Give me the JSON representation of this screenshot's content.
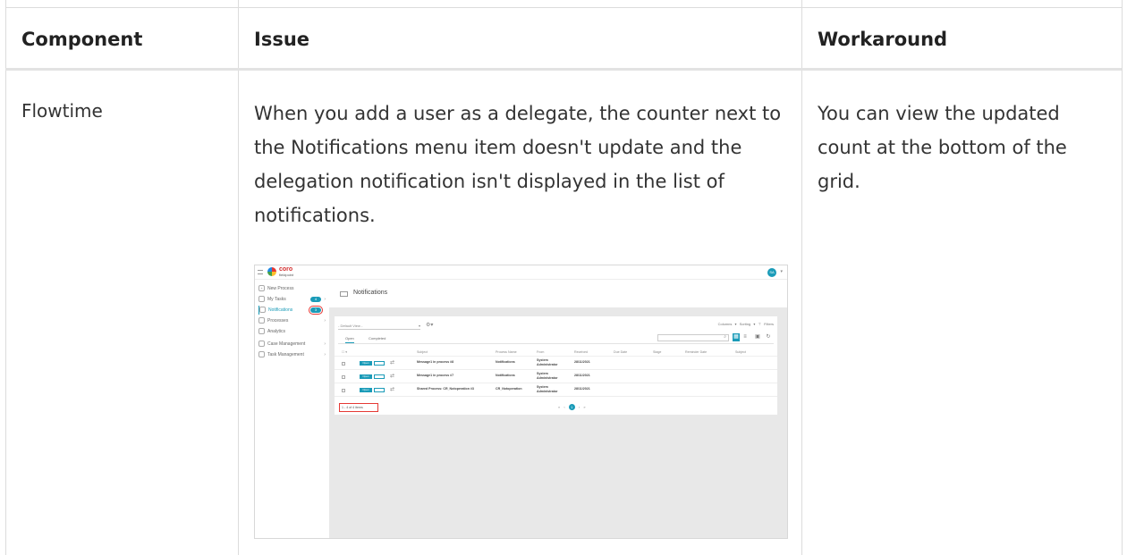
{
  "table": {
    "headers": {
      "component": "Component",
      "issue": "Issue",
      "workaround": "Workaround"
    },
    "rows": [
      {
        "component": "Flowtime",
        "issue": "When you add a user as a delegate, the counter next to the Notifications menu item doesn't update and the delegation notification isn't displayed in the list of notifications.",
        "workaround": "You can view the updated count at the bottom of the grid."
      }
    ]
  },
  "screenshot": {
    "logo": {
      "name": "coro",
      "sub": "fieldpoint"
    },
    "avatar": "SA",
    "nav": [
      {
        "label": "New Process",
        "icon": "plus-icon"
      },
      {
        "label": "My Tasks",
        "icon": "tasks-icon",
        "badge": "4"
      },
      {
        "label": "Notifications",
        "icon": "mail-icon",
        "badge": "3",
        "active": true
      },
      {
        "label": "Processes",
        "icon": "processes-icon"
      },
      {
        "label": "Analytics",
        "icon": "analytics-icon"
      },
      {
        "label": "Case Management",
        "icon": "folder-icon"
      },
      {
        "label": "Task Management",
        "icon": "clipboard-icon"
      }
    ],
    "page_title": "Notifications",
    "view_select": "- Default View -",
    "toolbar_right": "Columns ▾  Sorting ▾  ⊤ Filters",
    "tabs": [
      "Open",
      "Completed"
    ],
    "columns": [
      "Subject",
      "Process Name",
      "From",
      "Received",
      "Due Date",
      "Stage",
      "Reminder Date",
      "Subject"
    ],
    "rows": [
      {
        "status": "Open",
        "subject": "Message1 in process #8",
        "process": "Notifications",
        "from1": "System",
        "from2": "Administrator",
        "received": "28/11/2021"
      },
      {
        "status": "Open",
        "subject": "Message1 in process #7",
        "process": "Notifications",
        "from1": "System",
        "from2": "Administrator",
        "received": "28/11/2021"
      },
      {
        "status": "Open",
        "subject": "Shared Process: CR_Notoperation #3",
        "process": "CR_Notoperation",
        "from1": "System",
        "from2": "Administrator",
        "received": "28/11/2021"
      }
    ],
    "item_count": "1 - 4 of 4 items",
    "pager_page": "1",
    "accent": "#1a9bb8",
    "highlight": "#e53935"
  }
}
